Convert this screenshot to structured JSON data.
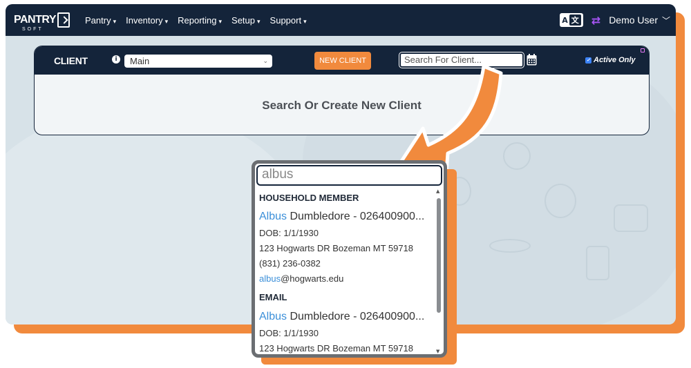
{
  "navbar": {
    "logo_text": "PANTRY",
    "logo_sub": "SOFT",
    "menu": [
      {
        "label": "Pantry"
      },
      {
        "label": "Inventory"
      },
      {
        "label": "Reporting"
      },
      {
        "label": "Setup"
      },
      {
        "label": "Support"
      }
    ],
    "lang_a": "A",
    "lang_b": "文",
    "user_name": "Demo User"
  },
  "client_panel": {
    "title": "CLIENT",
    "site_select_value": "Main",
    "new_client_label": "NEW CLIENT",
    "search_placeholder": "Search For Client...",
    "active_only_label": "Active Only",
    "active_only_checked": true,
    "body_text": "Search Or Create New Client"
  },
  "dropdown": {
    "query": "albus",
    "groups": [
      {
        "heading": "HOUSEHOLD MEMBER",
        "result": {
          "name_highlight": "Albus",
          "name_rest": " Dumbledore - 026400900...",
          "dob": "DOB: 1/1/1930",
          "address": "123 Hogwarts DR Bozeman MT 59718",
          "phone": "(831) 236-0382",
          "email_highlight": "albus",
          "email_rest": "@hogwarts.edu"
        }
      },
      {
        "heading": "EMAIL",
        "result": {
          "name_highlight": "Albus",
          "name_rest": " Dumbledore - 026400900...",
          "dob": "DOB: 1/1/1930",
          "address": "123 Hogwarts DR Bozeman MT 59718"
        }
      }
    ]
  },
  "colors": {
    "navy": "#14243a",
    "orange": "#f18a3d",
    "highlight": "#3b8fd9",
    "background": "#d7e2e8"
  }
}
